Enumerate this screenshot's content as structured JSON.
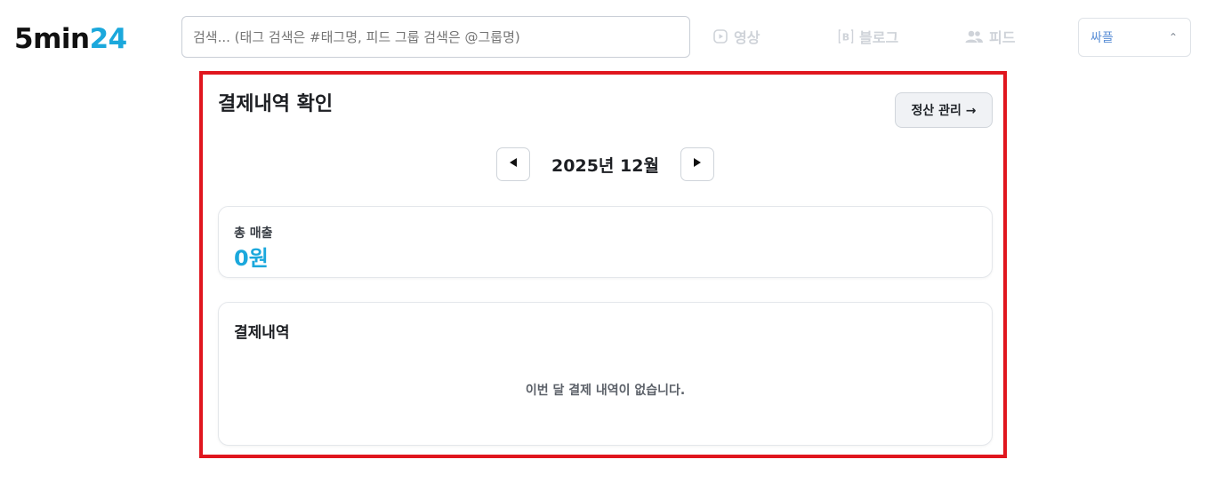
{
  "header": {
    "logo_part1": "5min",
    "logo_part2": "24",
    "logo_accent": "#1ba8dc",
    "search_placeholder": "검색... (태그 검색은 #태그명, 피드 그룹 검색은 @그룹명)",
    "nav": [
      {
        "label": "영상",
        "icon": "video-icon"
      },
      {
        "label": "블로그",
        "icon": "blog-icon"
      },
      {
        "label": "피드",
        "icon": "users-icon"
      }
    ],
    "user_name": "싸플",
    "user_menu_icon": "chevron-up-icon"
  },
  "main": {
    "title": "결제내역 확인",
    "settle_button": "정산 관리 →",
    "month": "2025년 12월",
    "prev_icon": "caret-left-icon",
    "next_icon": "caret-right-icon",
    "sales_label": "총 매출",
    "sales_value": "0원",
    "payments_title": "결제내역",
    "empty_message": "이번 달 결제 내역이 없습니다.",
    "highlight_color": "#e0161e"
  }
}
